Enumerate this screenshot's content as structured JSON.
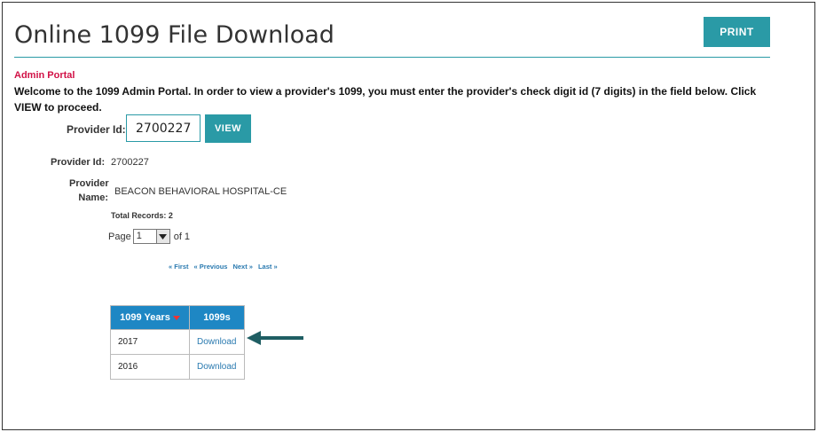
{
  "page": {
    "title": "Online 1099 File Download",
    "print_label": "PRINT"
  },
  "portal": {
    "label": "Admin Portal",
    "welcome": "Welcome to the 1099 Admin Portal. In order to view a provider's 1099, you must enter the provider's check digit id (7 digits) in the field below. Click VIEW to proceed."
  },
  "search": {
    "label": "Provider Id:",
    "value": "2700227",
    "view_label": "VIEW"
  },
  "provider": {
    "id_label": "Provider Id:",
    "id_value": "2700227",
    "name_label_1": "Provider",
    "name_label_2": "Name:",
    "name_value": "BEACON BEHAVIORAL HOSPITAL-CE"
  },
  "pager": {
    "total": "Total Records: 2",
    "page_label": "Page",
    "page_value": "1",
    "of_label": "of 1",
    "first": "« First",
    "previous": "« Previous",
    "next": "Next »",
    "last": "Last »"
  },
  "table": {
    "headers": [
      "1099 Years",
      "1099s"
    ],
    "rows": [
      {
        "year": "2017",
        "link": "Download"
      },
      {
        "year": "2016",
        "link": "Download"
      }
    ]
  },
  "colors": {
    "accent": "#2a9aa6",
    "header_blue": "#1e87c4",
    "alert_red": "#d11146",
    "link_blue": "#2a7ab0"
  },
  "icons": {
    "sort": "sort-desc-icon",
    "dropdown": "chevron-down-icon",
    "annotation": "arrow-left-icon"
  }
}
